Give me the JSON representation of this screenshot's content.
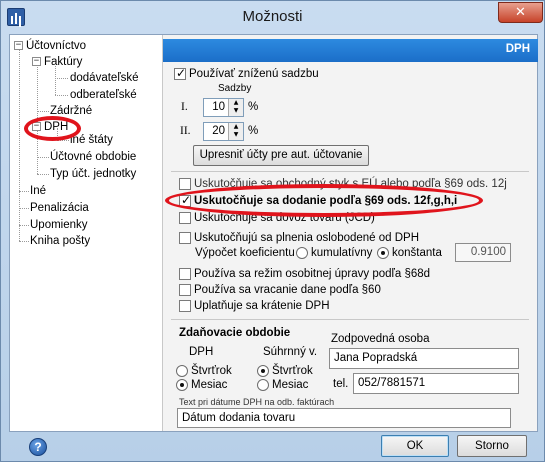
{
  "window": {
    "title": "Možnosti",
    "close_glyph": "✕"
  },
  "tree": {
    "items": [
      {
        "label": "Účtovníctvo"
      },
      {
        "label": "Faktúry"
      },
      {
        "label": "dodávateľské"
      },
      {
        "label": "odberateľské"
      },
      {
        "label": "Zádržné"
      },
      {
        "label": "DPH"
      },
      {
        "label": "iné štáty"
      },
      {
        "label": "Účtovné obdobie"
      },
      {
        "label": "Typ účt. jednotky"
      },
      {
        "label": "Iné"
      },
      {
        "label": "Penalizácia"
      },
      {
        "label": "Upomienky"
      },
      {
        "label": "Kniha pošty"
      }
    ]
  },
  "panel": {
    "header": "DPH",
    "reduced_rate": {
      "label": "Používať zníženú sadzbu",
      "checked": true
    },
    "rates_label": "Sadzby",
    "rate1": {
      "roman": "I.",
      "value": "10",
      "unit": "%"
    },
    "rate2": {
      "roman": "II.",
      "value": "20",
      "unit": "%"
    },
    "adjust_button": "Upresniť účty pre aut. účtovanie",
    "opt_eu_ops": {
      "label": "Uskutočňuje sa obchodný styk s EÚ alebo podľa §69 ods. 12j",
      "checked": false
    },
    "opt_supply": {
      "label": "Uskutočňuje sa dodanie podľa §69 ods. 12f,g,h,i",
      "checked": true
    },
    "opt_import": {
      "label": "Uskutočňuje sa dovoz tovaru (JCD)",
      "checked": false
    },
    "opt_exempt": {
      "label": "Uskutočňujú sa plnenia oslobodené od DPH",
      "checked": false
    },
    "coef_label": "Výpočet koeficientu",
    "coef_cumulative": "kumulatívny",
    "coef_constant": "konštanta",
    "coef_value": "0.9100",
    "opt_special": {
      "label": "Používa sa režim osobitnej úpravy podľa §68d",
      "checked": false
    },
    "opt_refund": {
      "label": "Používa sa vracanie dane podľa §60",
      "checked": false
    },
    "opt_shortening": {
      "label": "Uplatňuje sa krátenie DPH",
      "checked": false
    },
    "tax_period": {
      "title": "Zdaňovacie obdobie",
      "dph_label": "DPH",
      "summary_label": "Súhrnný v.",
      "quarterly": "Štvrťrok",
      "monthly": "Mesiac"
    },
    "responsible": {
      "label": "Zodpovedná osoba",
      "name": "Jana Popradská",
      "tel_label": "tel.",
      "phone": "052/7881571"
    },
    "date_text": {
      "label": "Text pri dátume DPH na odb. faktúrach",
      "value": "Dátum dodania tovaru"
    }
  },
  "footer": {
    "help_glyph": "?",
    "ok_label": "OK",
    "cancel_label": "Storno"
  },
  "colors": {
    "header": "#1b6ec8",
    "highlight": "#e0141c"
  }
}
